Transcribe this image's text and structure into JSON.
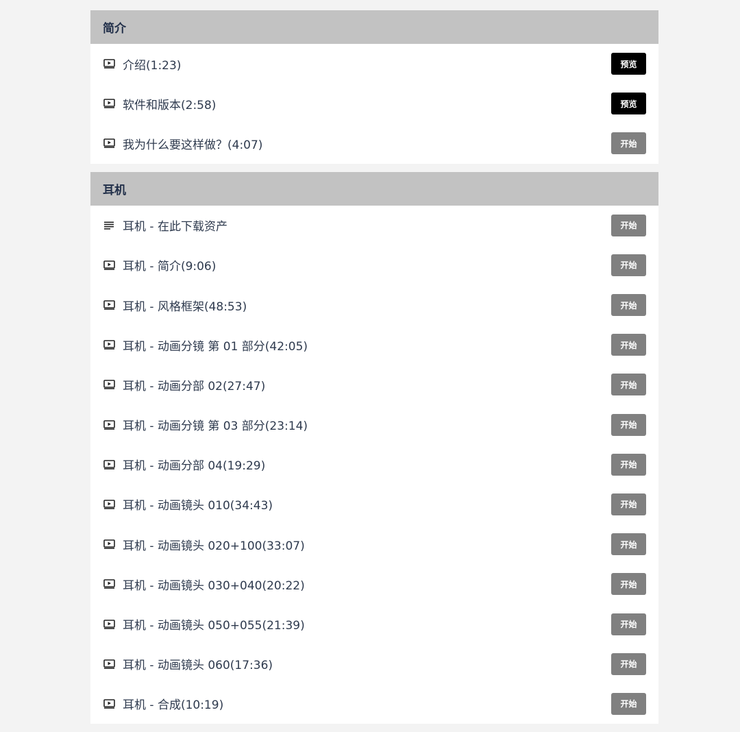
{
  "sections": [
    {
      "title": "简介",
      "lectures": [
        {
          "icon": "video-icon",
          "title": "介绍(1:23)",
          "button": "预览",
          "button_type": "preview"
        },
        {
          "icon": "video-icon",
          "title": "软件和版本(2:58)",
          "button": "预览",
          "button_type": "preview"
        },
        {
          "icon": "video-icon",
          "title": "我为什么要这样做？(4:07)",
          "button": "开始",
          "button_type": "start"
        }
      ]
    },
    {
      "title": "耳机",
      "lectures": [
        {
          "icon": "text-icon",
          "title": "耳机 - 在此下载资产",
          "button": "开始",
          "button_type": "start"
        },
        {
          "icon": "video-icon",
          "title": "耳机 - 简介(9:06)",
          "button": "开始",
          "button_type": "start"
        },
        {
          "icon": "video-icon",
          "title": "耳机 - 风格框架(48:53)",
          "button": "开始",
          "button_type": "start"
        },
        {
          "icon": "video-icon",
          "title": "耳机 - 动画分镜 第 01 部分(42:05)",
          "button": "开始",
          "button_type": "start"
        },
        {
          "icon": "video-icon",
          "title": "耳机 - 动画分部 02(27:47)",
          "button": "开始",
          "button_type": "start"
        },
        {
          "icon": "video-icon",
          "title": "耳机 - 动画分镜 第 03 部分(23:14)",
          "button": "开始",
          "button_type": "start"
        },
        {
          "icon": "video-icon",
          "title": "耳机 - 动画分部 04(19:29)",
          "button": "开始",
          "button_type": "start"
        },
        {
          "icon": "video-icon",
          "title": "耳机 - 动画镜头 010(34:43)",
          "button": "开始",
          "button_type": "start"
        },
        {
          "icon": "video-icon",
          "title": "耳机 - 动画镜头 020+100(33:07)",
          "button": "开始",
          "button_type": "start"
        },
        {
          "icon": "video-icon",
          "title": "耳机 - 动画镜头 030+040(20:22)",
          "button": "开始",
          "button_type": "start"
        },
        {
          "icon": "video-icon",
          "title": "耳机 - 动画镜头 050+055(21:39)",
          "button": "开始",
          "button_type": "start"
        },
        {
          "icon": "video-icon",
          "title": "耳机 - 动画镜头 060(17:36)",
          "button": "开始",
          "button_type": "start"
        },
        {
          "icon": "video-icon",
          "title": "耳机 - 合成(10:19)",
          "button": "开始",
          "button_type": "start"
        }
      ]
    }
  ],
  "colors": {
    "page_bg": "#f3f3f3",
    "header_bg": "#c2c2c2",
    "preview_btn": "#000000",
    "start_btn": "#808080",
    "text": "#2e3a4e"
  }
}
